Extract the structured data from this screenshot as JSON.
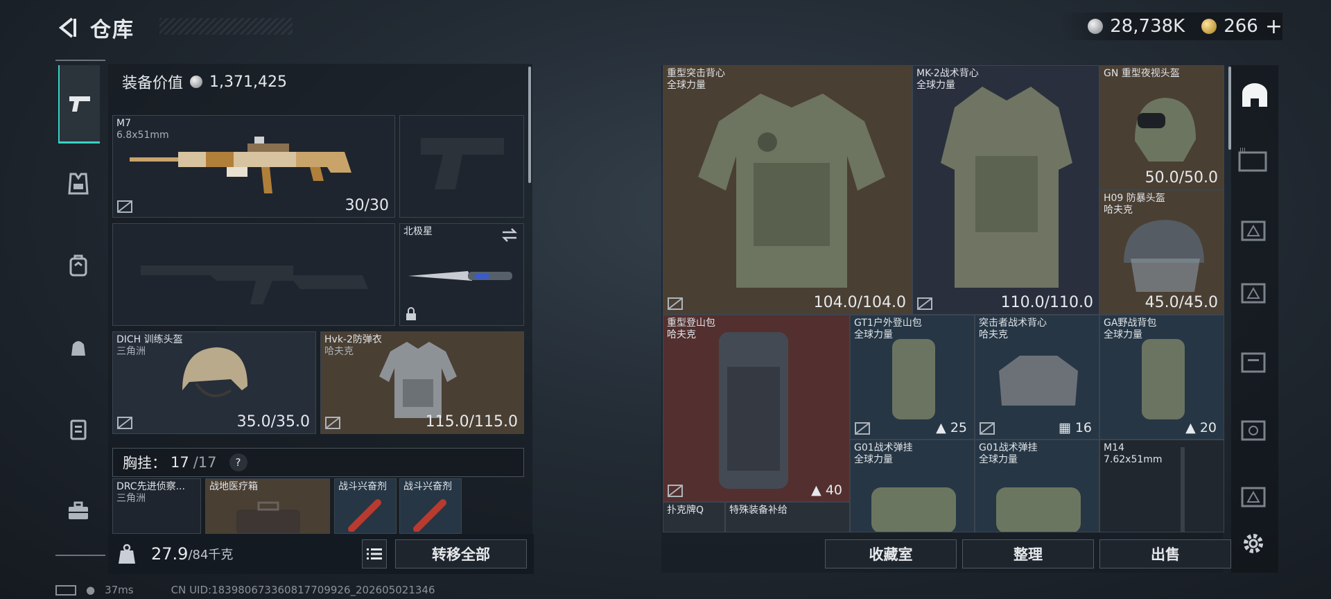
{
  "header": {
    "title": "仓库"
  },
  "currency": {
    "silver": "28,738K",
    "gold": "266",
    "plus": "+"
  },
  "equipment": {
    "value_label": "装备价值",
    "value": "1,371,425"
  },
  "loadout": {
    "primary": {
      "name": "M7",
      "caliber": "6.8x51mm",
      "ammo": "30/30"
    },
    "melee": {
      "name": "北极星"
    },
    "helmet": {
      "name": "DICH 训练头盔",
      "origin": "三角洲",
      "durability": "35.0/35.0"
    },
    "armor": {
      "name": "Hvk-2防弹衣",
      "origin": "哈夫克",
      "durability": "115.0/115.0"
    }
  },
  "chest": {
    "label": "胸挂：",
    "current": "17",
    "max": "/17",
    "help": "?"
  },
  "chest_items": [
    {
      "name": "DRC先进侦察...",
      "origin": "三角洲"
    },
    {
      "name": "战地医疗箱"
    },
    {
      "name": "战斗兴奋剂"
    },
    {
      "name": "战斗兴奋剂"
    }
  ],
  "weight": {
    "current": "27.9",
    "max": "/84千克"
  },
  "buttons": {
    "transfer_all": "转移全部",
    "collection": "收藏室",
    "organize": "整理",
    "sell": "出售"
  },
  "stash": [
    {
      "name": "重型突击背心",
      "origin": "全球力量",
      "value": "104.0/104.0"
    },
    {
      "name": "MK-2战术背心",
      "origin": "全球力量",
      "value": "110.0/110.0"
    },
    {
      "name": "GN 重型夜视头盔",
      "value": "50.0/50.0"
    },
    {
      "name": "H09 防暴头盔",
      "origin": "哈夫克",
      "value": "45.0/45.0"
    },
    {
      "name": "重型登山包",
      "origin": "哈夫克",
      "count": "40"
    },
    {
      "name": "GT1户外登山包",
      "origin": "全球力量",
      "count": "25"
    },
    {
      "name": "突击者战术背心",
      "origin": "哈夫克",
      "count": "16"
    },
    {
      "name": "GA野战背包",
      "origin": "全球力量",
      "count": "20"
    },
    {
      "name": "G01战术弹挂",
      "origin": "全球力量"
    },
    {
      "name": "G01战术弹挂",
      "origin": "全球力量"
    },
    {
      "name": "M14",
      "origin": "7.62x51mm"
    },
    {
      "name": "扑克牌Q"
    },
    {
      "name": "特殊装备补给"
    }
  ],
  "right_tabs": [
    "home-icon",
    "tier3-case-icon",
    "tier3-box-icon",
    "tier3-box2-icon",
    "tier2-case-icon",
    "tier4-case-icon",
    "tier4-box-icon"
  ],
  "status": {
    "ping": "37ms",
    "uid": "CN UID:18398067336081770992​6_202605021346"
  }
}
